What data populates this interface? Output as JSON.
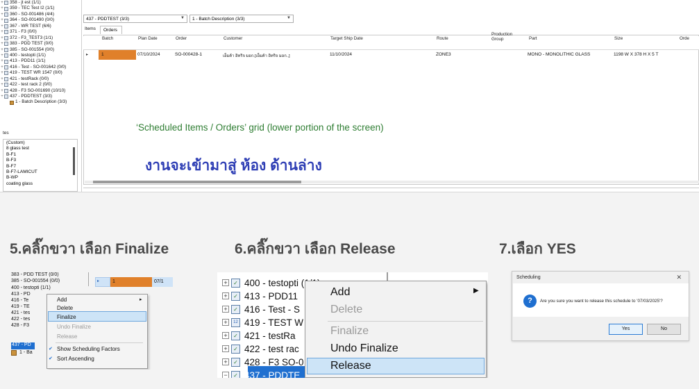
{
  "top": {
    "tree_items": [
      "358 - jt est (1/1)",
      "359 - TEC Test I2 (1/1)",
      "360 - SO-001486 (4/4)",
      "364 - SO-001490 (0/0)",
      "367 - WR TEST (6/6)",
      "371 - F3 (0/0)",
      "372 - F3_TEST3 (1/1)",
      "383 - PDD TEST (0/0)",
      "385 - SO-001554 (0/0)",
      "400 - testopti (1/1)",
      "413 - PDD11 (1/1)",
      "416 - Test - SO-001642 (0/0)",
      "419 - TEST WR 1547 (0/0)",
      "421 - testRack (0/0)",
      "422 - test rack 2 (0/0)",
      "428 - F3 SO-001690 (10/10)",
      "437 - PDDTEST (3/3)"
    ],
    "tree_child": "1 - Batch Description (3/3)",
    "attr_label": "tes",
    "attr_items": [
      "(Custom)",
      "8 glass test",
      "B-F1",
      "B-F3",
      "B-F7",
      "B-F7-LAMICUT",
      "B-WP",
      "coating glass"
    ],
    "combo_schedule": "437 - PDDTEST (3/3)",
    "combo_batch": "1 - Batch Description (3/3)",
    "tab_items": "Items",
    "tab_orders": "Orders",
    "grid_headers": {
      "batch": "Batch",
      "plan_date": "Plan Date",
      "order": "Order",
      "customer": "Customer",
      "target_ship": "Target Ship Date",
      "route": "Route",
      "production_group_1": "Production",
      "production_group_2": "Group",
      "part": "Part",
      "size": "Size",
      "order_more": "Orde"
    },
    "grid_row": {
      "batch": "1",
      "plan_date": "07/10/2024",
      "order": "SO-000428-1",
      "customer": "เอ็มค้า อิทริจ มอก.[เอ็มค้า อิทริจ มอก.,]",
      "target_ship": "11/10/2024",
      "route": "ZONE3",
      "part": "MONO - MONOLITHIC GLASS",
      "size": "1198 W X 378 H X 5 T"
    },
    "caption_en": "‘Scheduled Items / Orders’ grid (lower portion of the screen)",
    "caption_th": "งานจะเข้ามาสู่ ห้อง ด้านล่าง"
  },
  "steps": {
    "step5": "5.คลิ๊กขวา เลือก Finalize",
    "step6": "6.คลิ๊กขวา เลือก Release",
    "step7": "7.เลือก YES"
  },
  "panel5": {
    "tree": [
      "383 - PDD TEST (0/0)",
      "385 - SO-001554 (0/0)",
      "400 - testopti (1/1)",
      "413 - PD",
      "416 - Te",
      "419 - TE",
      "421 - tes",
      "422 - tes",
      "428 - F3",
      "437 - PD",
      "1 - Ba"
    ],
    "row_batch": "1",
    "row_date": "07/1",
    "menu": {
      "add": "Add",
      "delete": "Delete",
      "finalize": "Finalize",
      "undo_finalize": "Undo Finalize",
      "release": "Release",
      "show_factors": "Show Scheduling Factors",
      "sort_ascending": "Sort Ascending"
    }
  },
  "panel6": {
    "tree": [
      "400 - testopti (1/1)",
      "413 - PDD11",
      "416 - Test - S",
      "419 - TEST W",
      "421 - testRa",
      "422 - test rac",
      "428 - F3 SO-0",
      "437 - PDDTE"
    ],
    "menu": {
      "add": "Add",
      "delete": "Delete",
      "finalize": "Finalize",
      "undo_finalize": "Undo Finalize",
      "release": "Release"
    }
  },
  "panel7": {
    "title": "Scheduling",
    "message": "Are you sure you want to release this schedule to '07/03/2025'?",
    "yes": "Yes",
    "no": "No"
  },
  "colors": {
    "batch_orange": "#e0802a",
    "selection_blue": "#1f6fd0",
    "caption_green": "#2e7d32",
    "caption_thai_blue": "#2f3fb5"
  }
}
